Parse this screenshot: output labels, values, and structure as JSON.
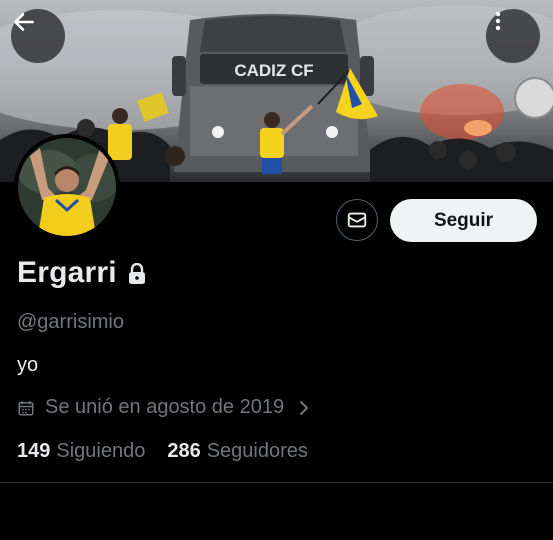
{
  "header": {
    "back_icon": "arrow-left-icon",
    "more_icon": "more-vertical-icon",
    "banner_text": "CADIZ CF"
  },
  "actions": {
    "message_icon": "envelope-icon",
    "follow_label": "Seguir"
  },
  "profile": {
    "name": "Ergarri",
    "protected_icon": "lock-icon",
    "handle": "@garrisimio",
    "bio": "yo",
    "joined": "Se unió en agosto de 2019",
    "joined_icon": "calendar-icon",
    "joined_chevron_icon": "chevron-right-icon"
  },
  "stats": {
    "following_count": "149",
    "following_label": "Siguiendo",
    "followers_count": "286",
    "followers_label": "Seguidores"
  },
  "colors": {
    "background": "#000000",
    "text_primary": "#e7e9ea",
    "text_secondary": "#71767b",
    "button_light": "#eff3f4",
    "club_yellow": "#f5d21b",
    "club_blue": "#1f4fa8"
  }
}
